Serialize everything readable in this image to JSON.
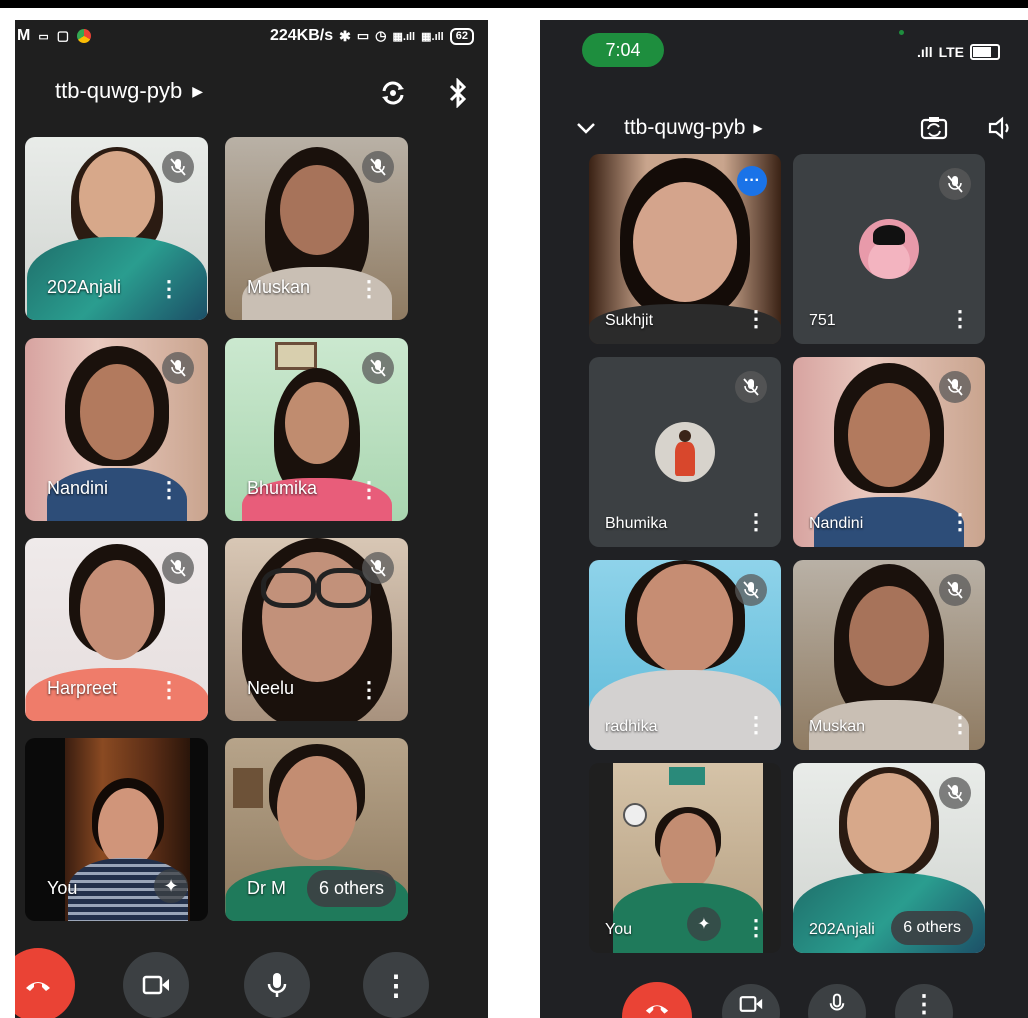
{
  "left_phone": {
    "status": {
      "left_text": "M",
      "speed": "224KB/s",
      "battery": "62"
    },
    "meeting_code": "ttb-quwg-pyb",
    "participants": [
      {
        "name": "202Anjali"
      },
      {
        "name": "Muskan"
      },
      {
        "name": "Nandini"
      },
      {
        "name": "Bhumika"
      },
      {
        "name": "Harpreet"
      },
      {
        "name": "Neelu"
      },
      {
        "name": "You"
      },
      {
        "name": "Dr M"
      }
    ],
    "others_label": "6 others"
  },
  "right_phone": {
    "status": {
      "time": "7:04",
      "network": "LTE"
    },
    "meeting_code": "ttb-quwg-pyb",
    "participants": [
      {
        "name": "Sukhjit"
      },
      {
        "name": "751"
      },
      {
        "name": "Bhumika"
      },
      {
        "name": "Nandini"
      },
      {
        "name": "radhika"
      },
      {
        "name": "Muskan"
      },
      {
        "name": "You"
      },
      {
        "name": "202Anjali"
      }
    ],
    "others_label": "6 others"
  },
  "colors": {
    "end_call": "#ea4335",
    "control_bg": "#3c4043",
    "time_pill": "#1e8e3e",
    "more_blue": "#1a73e8"
  },
  "icons": [
    "mic-off-icon",
    "more-vert-icon",
    "camera-icon",
    "mic-icon",
    "end-call-icon",
    "bluetooth-icon",
    "flip-camera-icon",
    "speaker-icon",
    "chevron-down-icon",
    "sparkle-icon"
  ]
}
